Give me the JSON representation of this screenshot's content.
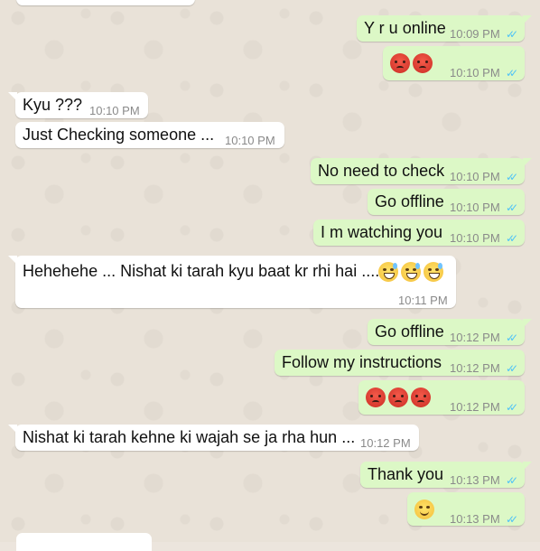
{
  "messages": [
    {
      "dir": "out",
      "text": "Y r u online",
      "time": "10:09 PM",
      "read": true
    },
    {
      "dir": "out",
      "emojis": [
        "angry-face",
        "angry-face"
      ],
      "time": "10:10 PM",
      "read": true
    },
    {
      "dir": "in",
      "text": "Kyu ???",
      "time": "10:10 PM"
    },
    {
      "dir": "in",
      "text": "Just Checking someone ...",
      "time": "10:10 PM"
    },
    {
      "dir": "out",
      "text": "No need to check",
      "time": "10:10 PM",
      "read": true
    },
    {
      "dir": "out",
      "text": "Go offline",
      "time": "10:10 PM",
      "read": true
    },
    {
      "dir": "out",
      "text": "I m watching you",
      "time": "10:10 PM",
      "read": true
    },
    {
      "dir": "in",
      "text": "Hehehehe ... Nishat ki tarah kyu baat kr rhi hai ....",
      "emojis": [
        "grinning-sweat-face",
        "grinning-sweat-face",
        "grinning-sweat-face"
      ],
      "time": "10:11 PM"
    },
    {
      "dir": "out",
      "text": "Go offline",
      "time": "10:12 PM",
      "read": true
    },
    {
      "dir": "out",
      "text": "Follow my instructions",
      "time": "10:12 PM",
      "read": true
    },
    {
      "dir": "out",
      "emojis": [
        "angry-face",
        "angry-face",
        "angry-face"
      ],
      "time": "10:12 PM",
      "read": true
    },
    {
      "dir": "in",
      "text": "Nishat ki tarah kehne ki wajah se ja rha hun ...",
      "time": "10:12 PM"
    },
    {
      "dir": "out",
      "text": "Thank you",
      "time": "10:13 PM",
      "read": true
    },
    {
      "dir": "out",
      "emojis": [
        "smiling-face"
      ],
      "time": "10:13 PM",
      "read": true
    }
  ],
  "colors": {
    "outgoing_bubble": "#dcf8c6",
    "incoming_bubble": "#ffffff",
    "read_ticks": "#4fc3f7",
    "wallpaper": "#e9e2d8"
  },
  "icons": {
    "read_receipt": "double-check-icon"
  }
}
